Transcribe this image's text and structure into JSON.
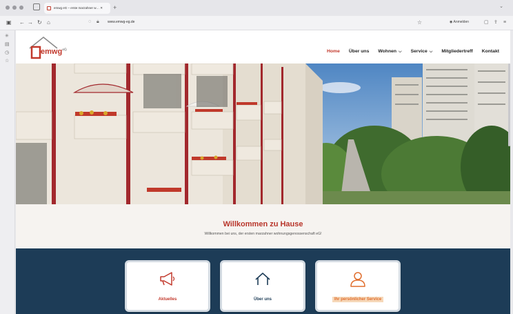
{
  "browser": {
    "tab_title": "emwg eG – erste marzahner w… ✕",
    "url": "www.emwg-eg.de",
    "new_tab": "+",
    "account_label": "Anmelden",
    "tab_overflow": "⌄"
  },
  "site": {
    "logo_text": "emwg",
    "logo_sup": "eG",
    "nav": [
      {
        "label": "Home"
      },
      {
        "label": "Über uns"
      },
      {
        "label": "Wohnen"
      },
      {
        "label": "Service"
      },
      {
        "label": "Mitgliedertreff"
      },
      {
        "label": "Kontakt"
      }
    ],
    "welcome_title": "Willkommen zu Hause",
    "welcome_subtitle": "Willkommen bei uns, der ersten marzahner wohnungsgenossenschaft eG!",
    "cards": [
      {
        "label": "Aktuelles",
        "icon": "megaphone-icon"
      },
      {
        "label": "Über uns",
        "icon": "house-icon"
      },
      {
        "label": "Ihr persönlicher Service",
        "icon": "person-icon"
      }
    ]
  },
  "colors": {
    "brand_red": "#c2382b",
    "navy": "#1d3c57",
    "orange": "#e06d2c"
  }
}
